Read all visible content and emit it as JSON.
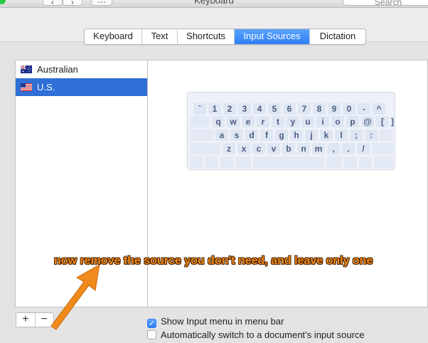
{
  "window": {
    "title": "Keyboard",
    "nav_back": "‹",
    "nav_forward": "›",
    "grid_label": "⋯",
    "search_placeholder": "Search"
  },
  "tabs": [
    {
      "label": "Keyboard",
      "active": false
    },
    {
      "label": "Text",
      "active": false
    },
    {
      "label": "Shortcuts",
      "active": false
    },
    {
      "label": "Input Sources",
      "active": true
    },
    {
      "label": "Dictation",
      "active": false
    }
  ],
  "sources": [
    {
      "label": "Australian",
      "flag": "australia-flag-icon",
      "selected": false
    },
    {
      "label": "U.S.",
      "flag": "us-flag-icon",
      "selected": true
    }
  ],
  "keyboard_preview": {
    "row1": [
      "`",
      "1",
      "2",
      "3",
      "4",
      "5",
      "6",
      "7",
      "8",
      "9",
      "0",
      "-",
      "^"
    ],
    "row2": [
      "q",
      "w",
      "e",
      "r",
      "t",
      "y",
      "u",
      "i",
      "o",
      "p",
      "@",
      "[",
      "]"
    ],
    "row3": [
      "a",
      "s",
      "d",
      "f",
      "g",
      "h",
      "j",
      "k",
      "l",
      ";",
      ":"
    ],
    "row4": [
      "z",
      "x",
      "c",
      "v",
      "b",
      "n",
      "m",
      ",",
      ".",
      "/"
    ]
  },
  "list_buttons": {
    "add": "+",
    "remove": "−"
  },
  "options": {
    "show_menu": {
      "label": "Show Input menu in menu bar",
      "checked": true
    },
    "auto_switch": {
      "label": "Automatically switch to a document’s input source",
      "checked": false
    }
  },
  "annotation": "now remove the source you don't need, and leave only one",
  "colors": {
    "accent": "#2f7ff6",
    "selection": "#2f6fd6",
    "annotation": "#f08a1c"
  }
}
